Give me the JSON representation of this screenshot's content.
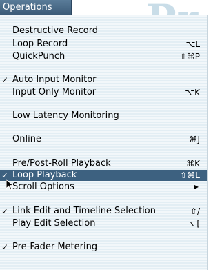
{
  "background": {
    "ghost_text": "Pr"
  },
  "menu": {
    "title": "Operations",
    "items": [
      {
        "label": "Destructive Record",
        "checked": "",
        "shortcut": ""
      },
      {
        "label": "Loop Record",
        "checked": "",
        "shortcut": "⌥L"
      },
      {
        "label": "QuickPunch",
        "checked": "",
        "shortcut": "⇧⌘P"
      },
      {
        "label": "Auto Input Monitor",
        "checked": "✓",
        "shortcut": ""
      },
      {
        "label": "Input Only Monitor",
        "checked": "",
        "shortcut": "⌥K"
      },
      {
        "label": "Low Latency Monitoring",
        "checked": "",
        "shortcut": ""
      },
      {
        "label": "Online",
        "checked": "",
        "shortcut": "⌘J"
      },
      {
        "label": "Pre/Post-Roll Playback",
        "checked": "",
        "shortcut": "⌘K"
      },
      {
        "label": "Loop Playback",
        "checked": "✓",
        "shortcut": "⇧⌘L"
      },
      {
        "label": "Scroll Options",
        "checked": "",
        "shortcut": ""
      },
      {
        "label": "Link Edit and Timeline Selection",
        "checked": "✓",
        "shortcut": "⇧/"
      },
      {
        "label": "Play Edit Selection",
        "checked": "",
        "shortcut": "⌥["
      },
      {
        "label": "Pre-Fader Metering",
        "checked": "✓",
        "shortcut": ""
      }
    ],
    "submenu_arrow": "▶"
  },
  "colors": {
    "menu_background": "#e3eef4",
    "selection_highlight": "#3d6180",
    "title_bar": "#4a6a88"
  },
  "icons": {
    "cursor": "arrow-pointer-icon",
    "check": "checkmark-icon",
    "submenu": "triangle-right-icon"
  }
}
